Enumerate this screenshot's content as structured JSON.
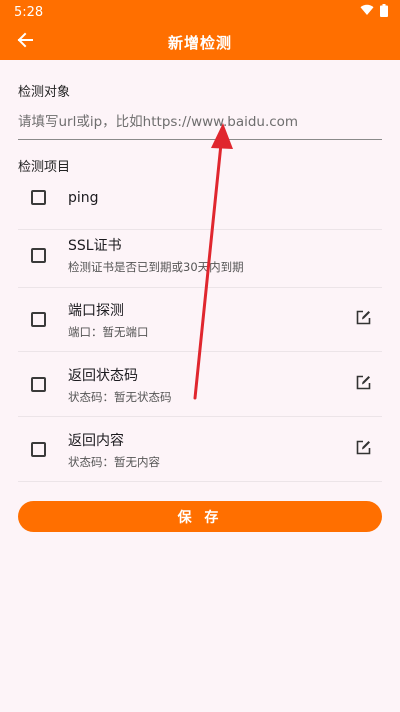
{
  "status_bar": {
    "time": "5:28",
    "wifi_icon": "wifi-icon",
    "battery_icon": "battery-icon"
  },
  "app_bar": {
    "title": "新增检测",
    "back_icon": "arrow-left-icon"
  },
  "target": {
    "label": "检测对象",
    "value": "",
    "placeholder": "请填写url或ip，比如https://www.baidu.com"
  },
  "items_label": "检测项目",
  "items": [
    {
      "title": "ping",
      "subtitle": "",
      "checked": false,
      "editable": false
    },
    {
      "title": "SSL证书",
      "subtitle": "检测证书是否已到期或30天内到期",
      "checked": false,
      "editable": false
    },
    {
      "title": "端口探测",
      "subtitle": "端口：暂无端口",
      "checked": false,
      "editable": true
    },
    {
      "title": "返回状态码",
      "subtitle": "状态码：暂无状态码",
      "checked": false,
      "editable": true
    },
    {
      "title": "返回内容",
      "subtitle": "状态码：暂无内容",
      "checked": false,
      "editable": true
    }
  ],
  "save_label": "保 存",
  "colors": {
    "accent": "#ff6f00",
    "background": "#fdf4f8",
    "annotation_arrow": "#e0262e"
  }
}
